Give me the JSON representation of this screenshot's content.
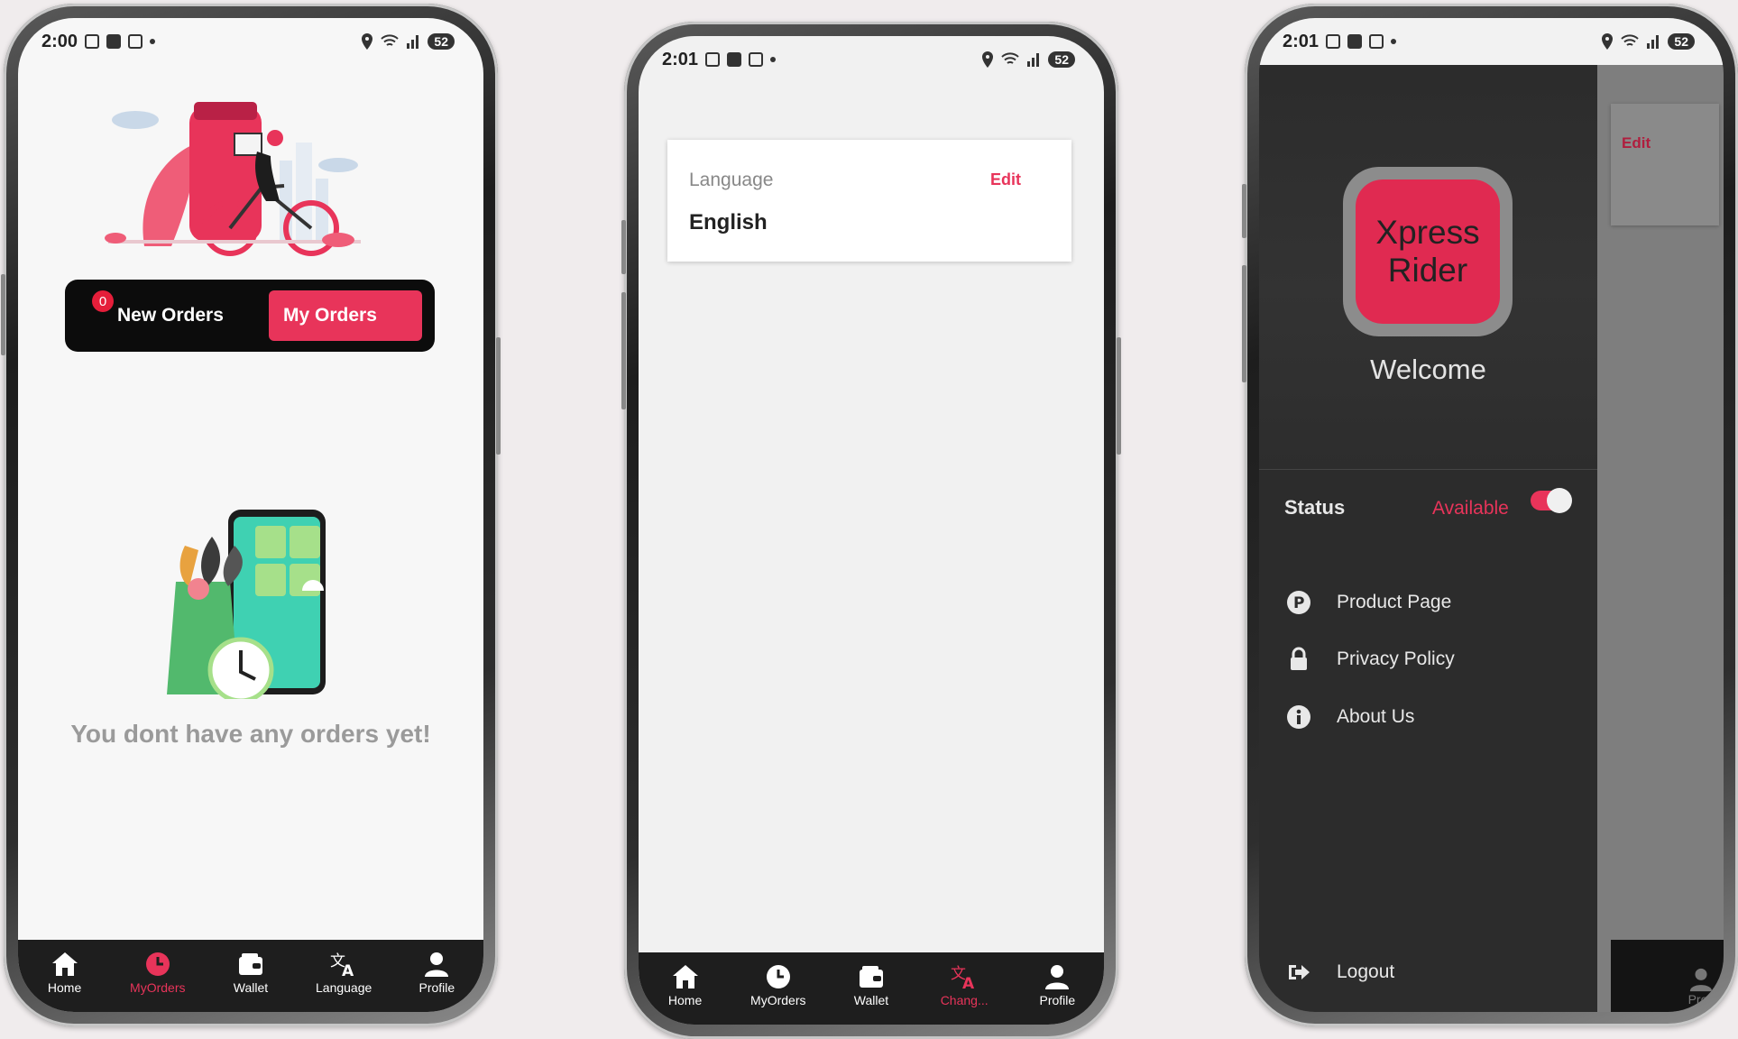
{
  "colors": {
    "accent": "#e8345a",
    "dark": "#1e1e1e"
  },
  "phone1": {
    "status": {
      "time": "2:00",
      "battery": "52"
    },
    "tabs": {
      "new_orders_count": "0",
      "new_orders": "New Orders",
      "my_orders": "My Orders"
    },
    "empty_message": "You dont have any orders yet!",
    "nav": [
      {
        "label": "Home",
        "icon": "home-icon"
      },
      {
        "label": "MyOrders",
        "icon": "clock-icon"
      },
      {
        "label": "Wallet",
        "icon": "wallet-icon"
      },
      {
        "label": "Language",
        "icon": "translate-icon"
      },
      {
        "label": "Profile",
        "icon": "person-icon"
      }
    ]
  },
  "phone2": {
    "status": {
      "time": "2:01",
      "battery": "52"
    },
    "language_card": {
      "label": "Language",
      "edit": "Edit",
      "value": "English"
    },
    "nav": [
      {
        "label": "Home",
        "icon": "home-icon"
      },
      {
        "label": "MyOrders",
        "icon": "clock-icon"
      },
      {
        "label": "Wallet",
        "icon": "wallet-icon"
      },
      {
        "label": "Chang...",
        "icon": "translate-icon"
      },
      {
        "label": "Profile",
        "icon": "person-icon"
      }
    ]
  },
  "phone3": {
    "status": {
      "time": "2:01",
      "battery": "52"
    },
    "background_edit": "Edit",
    "background_profile": "Profi",
    "logo_text": "XpressRider",
    "welcome": "Welcome",
    "status_label": "Status",
    "status_value": "Available",
    "menu": [
      {
        "label": "Product Page",
        "icon": "product-p-icon"
      },
      {
        "label": "Privacy Policy",
        "icon": "lock-icon"
      },
      {
        "label": "About Us",
        "icon": "info-icon"
      }
    ],
    "logout": "Logout"
  }
}
